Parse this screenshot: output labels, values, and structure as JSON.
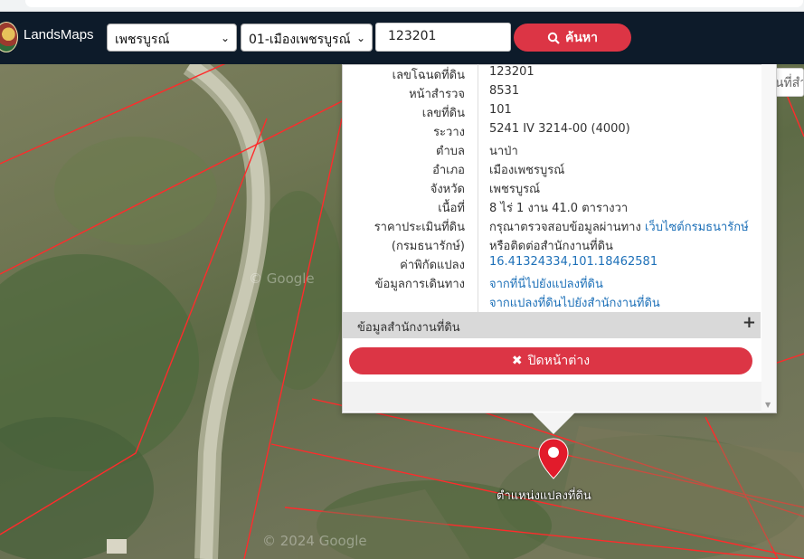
{
  "header": {
    "logo_text": "LandsMaps",
    "province_select": "เพชรบูรณ์",
    "amphoe_select": "01-เมืองเพชรบูรณ์",
    "search_value": "123201",
    "search_button": "ค้นหา"
  },
  "popup": {
    "rows": [
      {
        "label": "เลขโฉนดที่ดิน",
        "value": "123201"
      },
      {
        "label": "หน้าสำรวจ",
        "value": "8531"
      },
      {
        "label": "เลขที่ดิน",
        "value": "101"
      },
      {
        "label": "ระวาง",
        "value": "5241 IV 3214-00 (4000)"
      },
      {
        "label": "ตำบล",
        "value": "นาป่า"
      },
      {
        "label": "อำเภอ",
        "value": "เมืองเพชรบูรณ์"
      },
      {
        "label": "จังหวัด",
        "value": "เพชรบูรณ์"
      },
      {
        "label": "เนื้อที่",
        "value": "8 ไร่ 1 งาน 41.0 ตารางวา"
      }
    ],
    "price_label": "ราคาประเมินที่ดิน",
    "price_value": "กรุณาตรวจสอบข้อมูลผ่านทาง",
    "price_link": "เว็บไซต์กรมธนารักษ์",
    "treasury_label": "(กรมธนารักษ์)",
    "treasury_value": "หรือติดต่อสำนักงานที่ดิน",
    "coord_label": "ค่าพิกัดแปลง",
    "coord_value": "16.41324334,101.18462581",
    "route_label": "ข้อมูลการเดินทาง",
    "route_link_1": "จากที่นี่ไปยังแปลงที่ดิน",
    "route_link_2": "จากแปลงที่ดินไปยังสำนักงานที่ดิน",
    "office_section": "ข้อมูลสำนักงานที่ดิน",
    "close_button": "ปิดหน้าต่าง"
  },
  "map": {
    "right_search_placeholder": "ค้นหาสถานที่สำ",
    "marker_label": "ตำแหน่งแปลงที่ดิน",
    "watermark_1": "© Google",
    "watermark_2": "© 2024 Google"
  },
  "colors": {
    "header_bg": "#0d1b2a",
    "accent_red": "#dc3545",
    "link": "#1d70b8",
    "parcel_line": "#ff2b2b"
  }
}
